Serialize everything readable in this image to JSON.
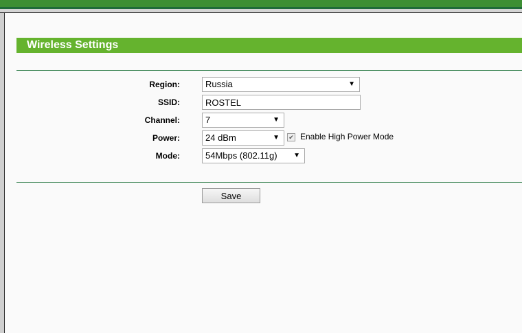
{
  "header": {
    "title": "Wireless Settings"
  },
  "form": {
    "region": {
      "label": "Region:",
      "value": "Russia"
    },
    "ssid": {
      "label": "SSID:",
      "value": "ROSTEL"
    },
    "channel": {
      "label": "Channel:",
      "value": "7"
    },
    "power": {
      "label": "Power:",
      "value": "24 dBm",
      "high_power_label": "Enable High Power Mode",
      "high_power_checked": true
    },
    "mode": {
      "label": "Mode:",
      "value": "54Mbps (802.11g)"
    }
  },
  "actions": {
    "save_label": "Save"
  },
  "colors": {
    "accent": "#65b32e",
    "rule": "#2f7d4a"
  }
}
